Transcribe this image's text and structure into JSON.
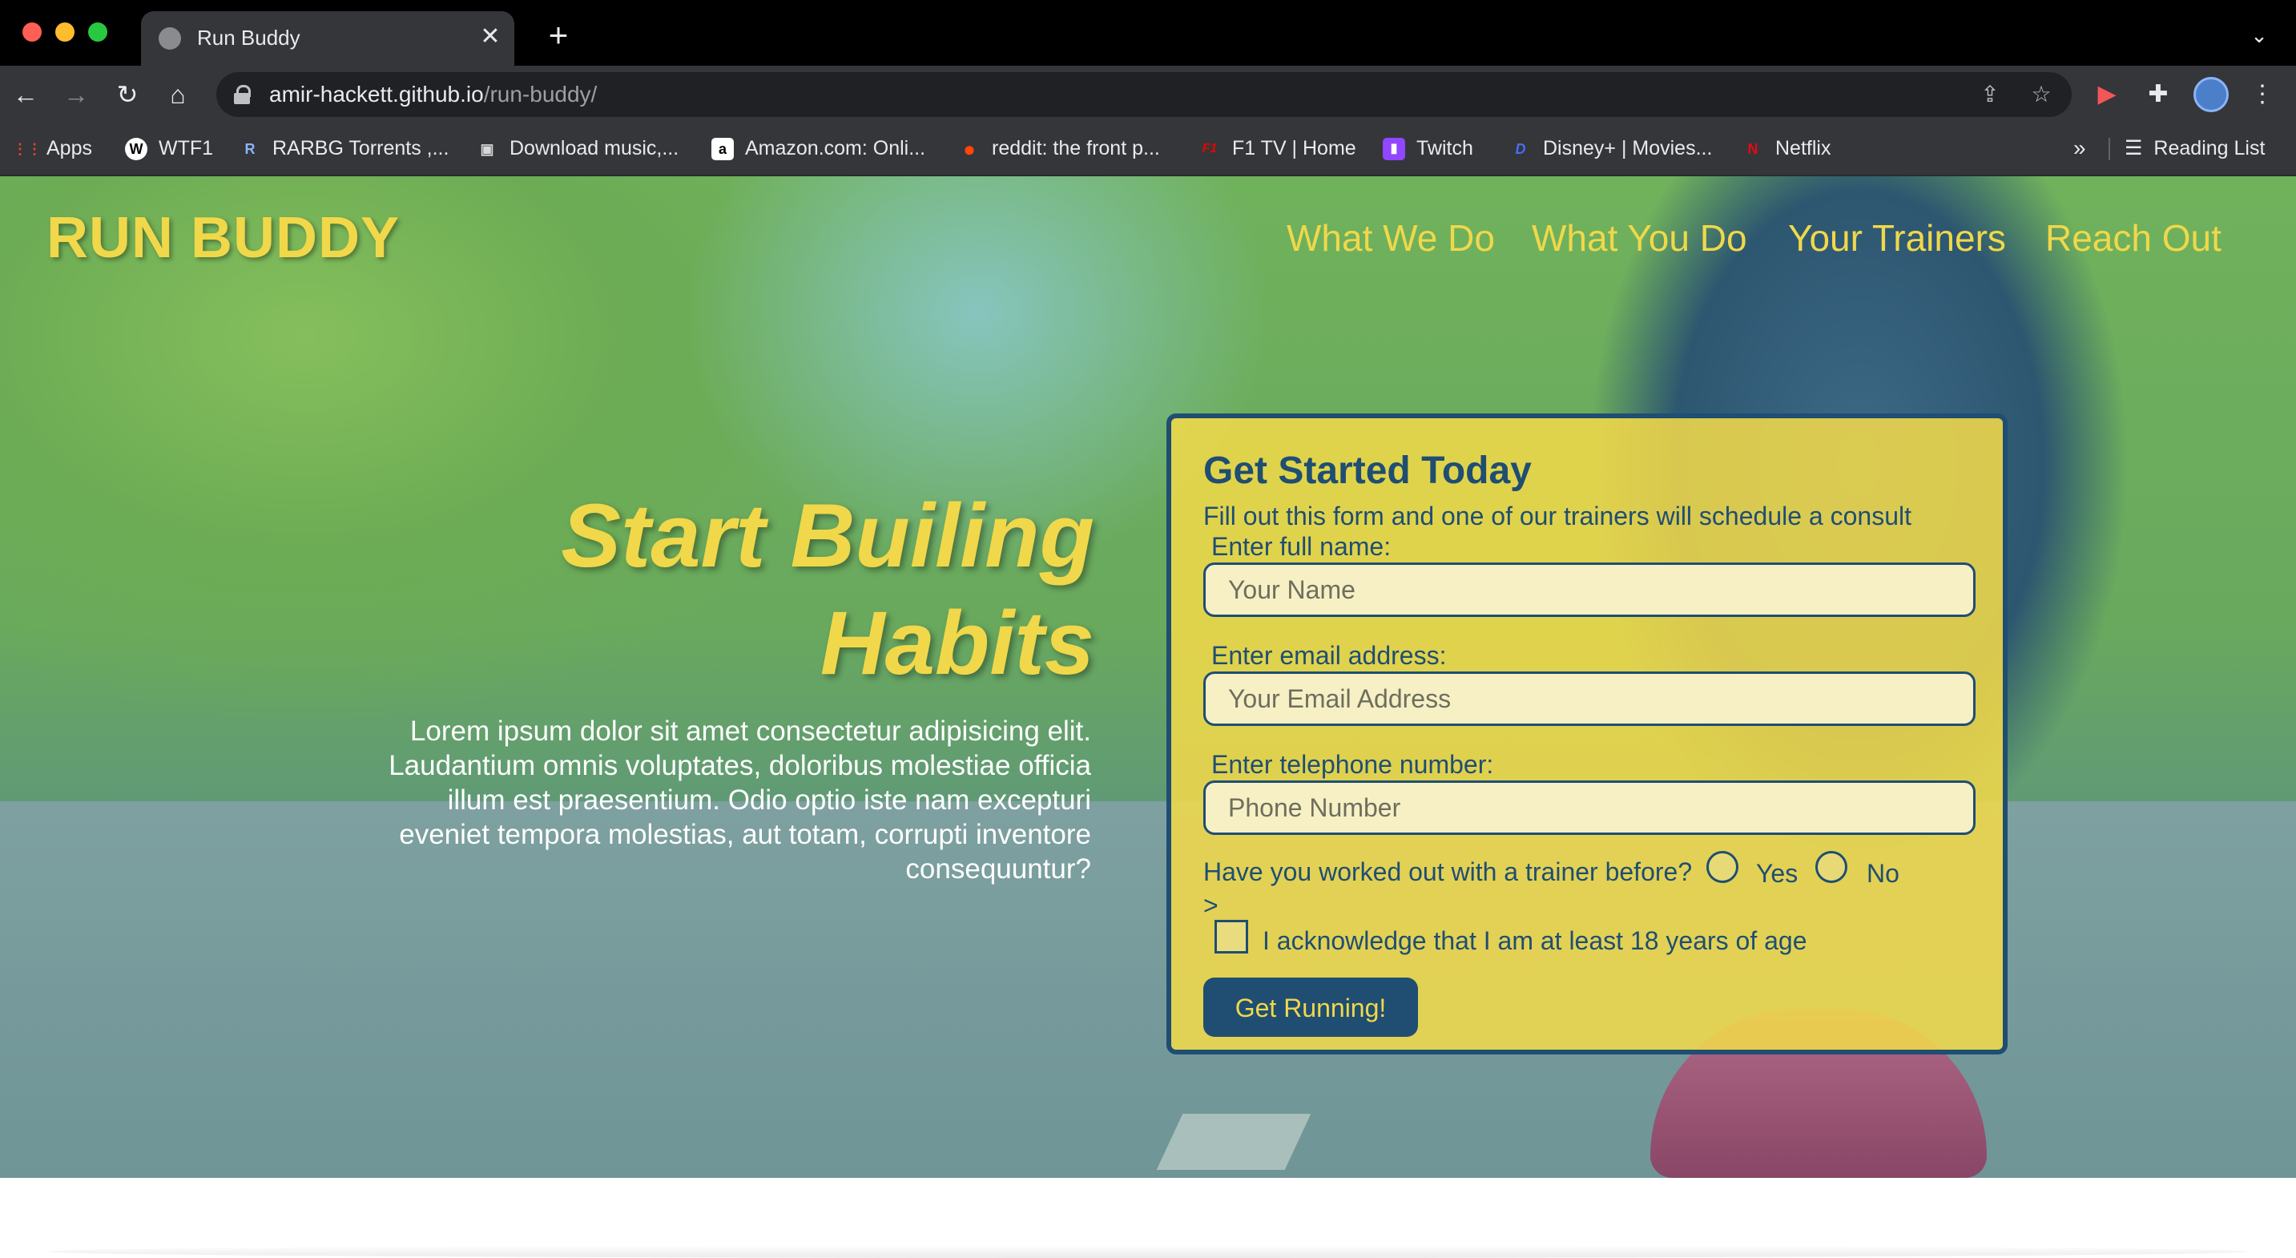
{
  "browser": {
    "tab": {
      "title": "Run Buddy",
      "close_glyph": "✕"
    },
    "new_tab_glyph": "+",
    "tab_menu_glyph": "⌄",
    "nav": {
      "back_glyph": "←",
      "forward_glyph": "→",
      "reload_glyph": "↻",
      "home_glyph": "⌂"
    },
    "url": {
      "host": "amir-hackett.github.io",
      "path": "/run-buddy/"
    },
    "omnibox_icons": {
      "share": "⇪",
      "star": "☆"
    },
    "extensions": {
      "video": "▶",
      "puzzle": "✚",
      "menu": "⋮"
    },
    "bookmarks": [
      {
        "label": "Apps",
        "icon": "apps-grid-icon",
        "glyph": "⋮⋮",
        "color": "#ea4335"
      },
      {
        "label": "WTF1",
        "icon": "wtf1-icon",
        "glyph": "W",
        "color": "#ffffff"
      },
      {
        "label": "RARBG Torrents ,...",
        "icon": "rarbg-icon",
        "glyph": "R",
        "color": "#4a74c9"
      },
      {
        "label": "Download music,...",
        "icon": "download-music-icon",
        "glyph": "▣",
        "color": "#d9d9d9"
      },
      {
        "label": "Amazon.com: Onli...",
        "icon": "amazon-icon",
        "glyph": "a",
        "color": "#ffffff"
      },
      {
        "label": "reddit: the front p...",
        "icon": "reddit-icon",
        "glyph": "●",
        "color": "#ff4500"
      },
      {
        "label": "F1 TV | Home",
        "icon": "f1-icon",
        "glyph": "F1",
        "color": "#e10600"
      },
      {
        "label": "Twitch",
        "icon": "twitch-icon",
        "glyph": "▮",
        "color": "#9146ff"
      },
      {
        "label": "Disney+ | Movies...",
        "icon": "disney-icon",
        "glyph": "D",
        "color": "#113ccf"
      },
      {
        "label": "Netflix",
        "icon": "netflix-icon",
        "glyph": "N",
        "color": "#e50914"
      }
    ],
    "bookmarks_more": "»",
    "reading_list": {
      "label": "Reading List",
      "glyph": "☰"
    }
  },
  "site": {
    "logo": "RUN BUDDY",
    "nav": [
      "What We Do",
      "What You Do",
      "Your Trainers",
      "Reach Out"
    ],
    "hero": {
      "headline_line1": "Start Builing",
      "headline_line2": "Habits",
      "body": "Lorem ipsum dolor sit amet consectetur adipisicing elit. Laudantium omnis voluptates, doloribus molestiae officia illum est praesentium. Odio optio iste nam excepturi eveniet tempora molestias, aut totam, corrupti inventore consequuntur?"
    },
    "form": {
      "title": "Get Started Today",
      "subtitle": "Fill out this form and one of our trainers will schedule a consult",
      "name_label": "Enter full name:",
      "name_placeholder": "Your Name",
      "email_label": "Enter email address:",
      "email_placeholder": "Your Email Address",
      "phone_label": "Enter telephone number:",
      "phone_placeholder": "Phone Number",
      "question": "Have you worked out with a trainer before?",
      "yes_label": "Yes",
      "no_label": "No",
      "stray_text": ">",
      "ack_label": "I acknowledge that I am at least 18 years of age",
      "submit_label": "Get Running!"
    }
  },
  "colors": {
    "accent_yellow": "#f0d84a",
    "navy": "#1f4e72",
    "chrome_dark": "#35363a"
  }
}
